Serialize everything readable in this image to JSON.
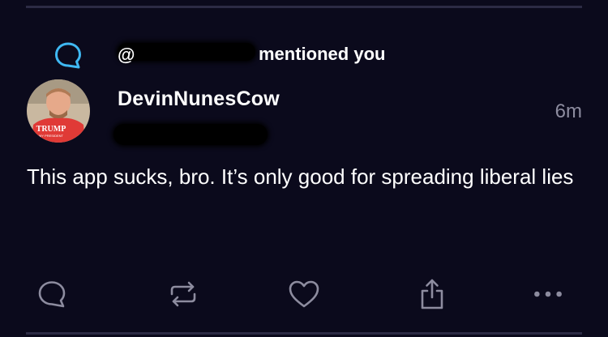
{
  "notification": {
    "handle": "@",
    "text": "mentioned you"
  },
  "post": {
    "display_name": "DevinNunesCow",
    "timestamp": "6m",
    "body": "This app sucks, bro. It’s only good for spreading liberal lies"
  },
  "avatar": {
    "shirt_text": "TRUMP",
    "shirt_subtext": "MY PRESIDENT"
  },
  "colors": {
    "background": "#0b0a1c",
    "accent": "#3fb8f2",
    "muted": "#8d8c9f",
    "divider": "#2c2b44"
  },
  "icons": [
    "reply-icon",
    "boost-icon",
    "favorite-icon",
    "share-icon",
    "more-icon"
  ]
}
